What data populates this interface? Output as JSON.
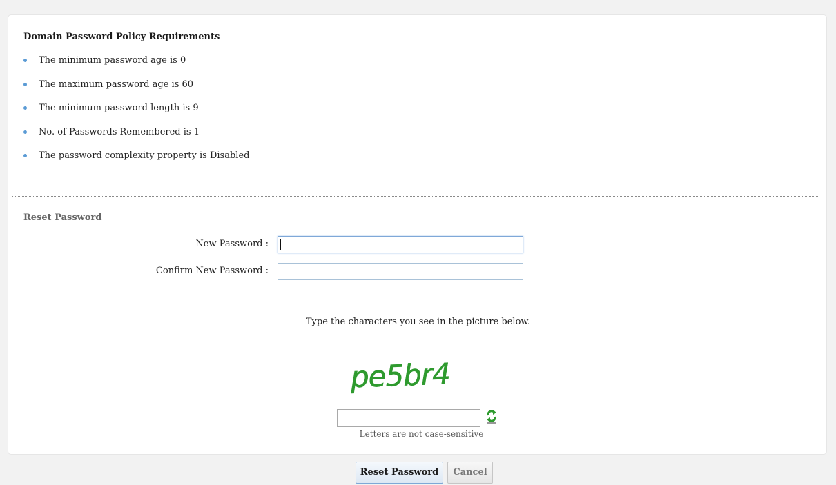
{
  "policy": {
    "title": "Domain Password Policy Requirements",
    "items": [
      "The minimum password age is 0",
      "The maximum password age is 60",
      "The minimum password length is 9",
      "No. of Passwords Remembered is 1",
      "The password complexity property is Disabled"
    ]
  },
  "reset": {
    "title": "Reset Password",
    "new_password_label": "New Password :",
    "new_password_value": "",
    "confirm_password_label": "Confirm New Password :",
    "confirm_password_value": ""
  },
  "captcha": {
    "prompt": "Type the characters you see in the picture below.",
    "image_text": "pe5br4",
    "text_color": "#2e9a2e",
    "input_value": "",
    "note": "Letters are not case-sensitive",
    "refresh_icon": "refresh-icon"
  },
  "actions": {
    "reset_label": "Reset Password",
    "cancel_label": "Cancel"
  },
  "colors": {
    "bullet": "#5b9bd5",
    "page_background": "#f2f2f2",
    "panel_background": "#ffffff"
  }
}
